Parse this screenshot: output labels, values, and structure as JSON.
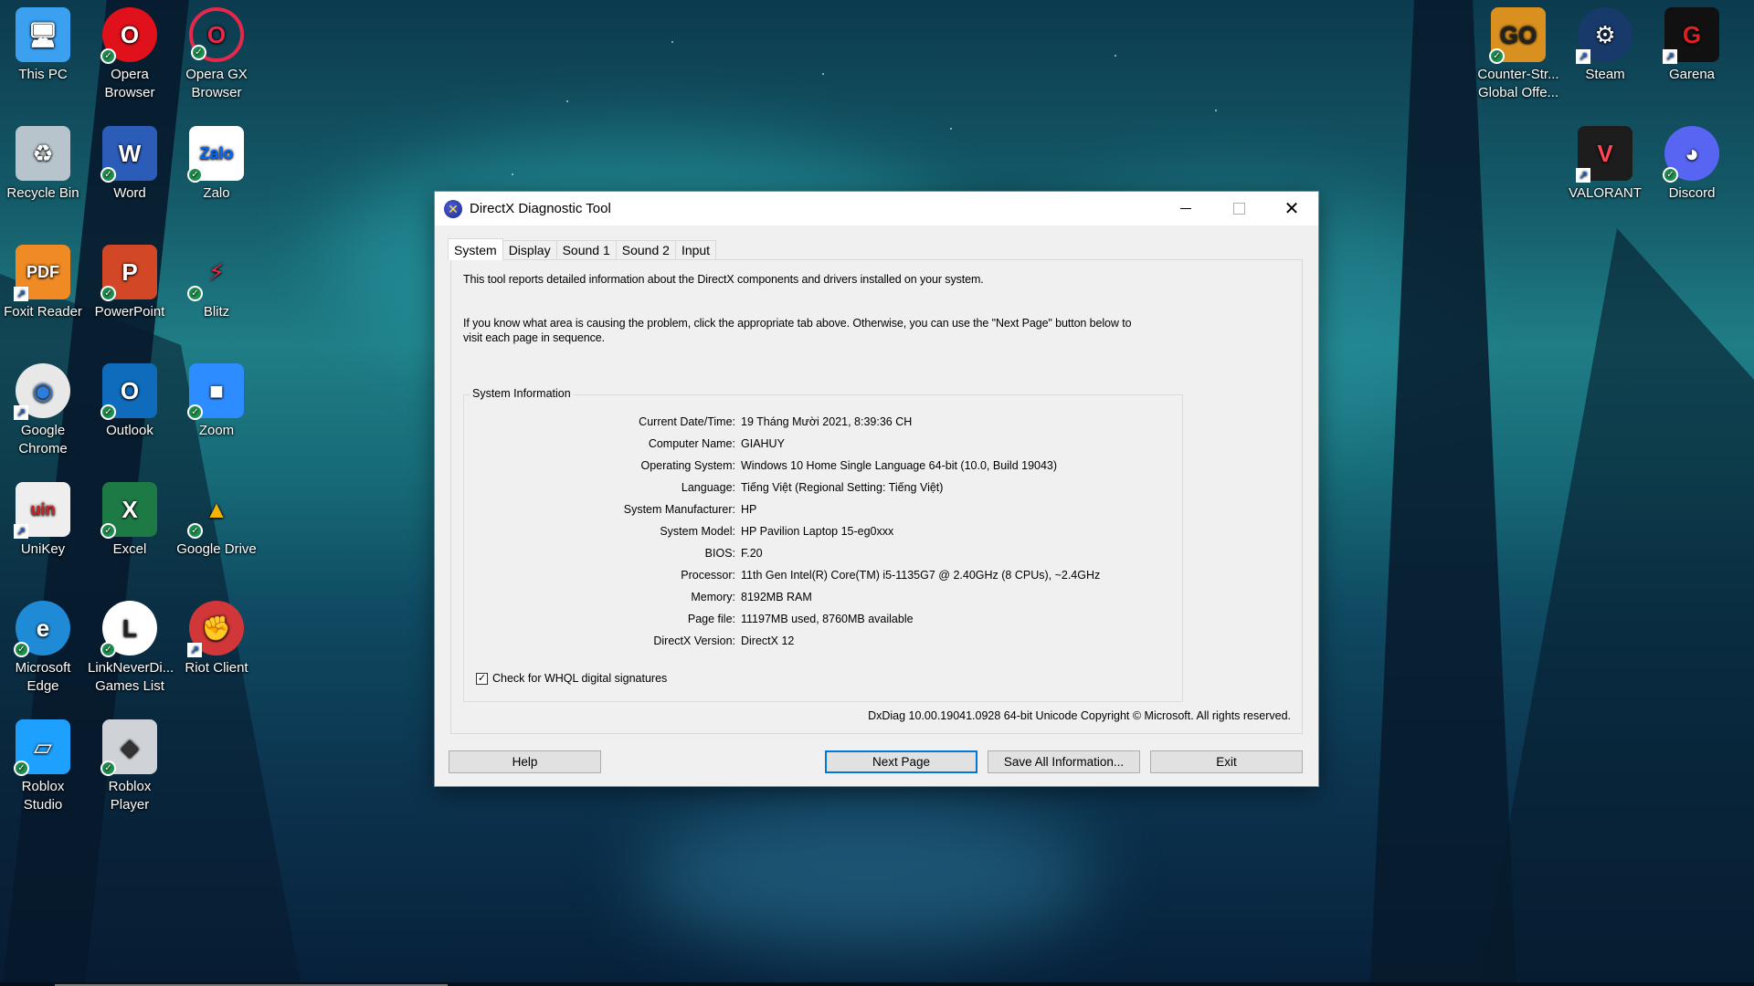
{
  "desktop": {
    "icons_left": [
      {
        "label": "This PC",
        "icon": "computer-icon",
        "badge": "none"
      },
      {
        "label": "Opera Browser",
        "icon": "opera-icon",
        "badge": "synced"
      },
      {
        "label": "Opera GX Browser",
        "icon": "opera-gx-icon",
        "badge": "synced"
      },
      {
        "label": "Recycle Bin",
        "icon": "recycle-bin-icon",
        "badge": "none"
      },
      {
        "label": "Word",
        "icon": "word-icon",
        "badge": "synced"
      },
      {
        "label": "Zalo",
        "icon": "zalo-icon",
        "badge": "synced"
      },
      {
        "label": "Foxit Reader",
        "icon": "foxit-reader-icon",
        "badge": "shortcut"
      },
      {
        "label": "PowerPoint",
        "icon": "powerpoint-icon",
        "badge": "synced"
      },
      {
        "label": "Blitz",
        "icon": "blitz-icon",
        "badge": "synced"
      },
      {
        "label": "Google Chrome",
        "icon": "chrome-icon",
        "badge": "shortcut"
      },
      {
        "label": "Outlook",
        "icon": "outlook-icon",
        "badge": "synced"
      },
      {
        "label": "Zoom",
        "icon": "zoom-icon",
        "badge": "synced"
      },
      {
        "label": "UniKey",
        "icon": "unikey-icon",
        "badge": "shortcut"
      },
      {
        "label": "Excel",
        "icon": "excel-icon",
        "badge": "synced"
      },
      {
        "label": "Google Drive",
        "icon": "google-drive-icon",
        "badge": "synced"
      },
      {
        "label": "Microsoft Edge",
        "icon": "edge-icon",
        "badge": "synced"
      },
      {
        "label": "LinkNeverDi... Games List",
        "icon": "linkneverdie-icon",
        "badge": "synced"
      },
      {
        "label": "Riot Client",
        "icon": "riot-client-icon",
        "badge": "shortcut"
      },
      {
        "label": "Roblox Studio",
        "icon": "roblox-studio-icon",
        "badge": "synced"
      },
      {
        "label": "Roblox Player",
        "icon": "roblox-player-icon",
        "badge": "synced"
      }
    ],
    "icons_right": [
      {
        "label": "Counter-Str... Global Offe...",
        "icon": "csgo-icon",
        "badge": "synced"
      },
      {
        "label": "Steam",
        "icon": "steam-icon",
        "badge": "shortcut"
      },
      {
        "label": "Garena",
        "icon": "garena-icon",
        "badge": "shortcut"
      },
      {
        "label": "VALORANT",
        "icon": "valorant-icon",
        "badge": "shortcut"
      },
      {
        "label": "Discord",
        "icon": "discord-icon",
        "badge": "synced"
      }
    ]
  },
  "dialog": {
    "title": "DirectX Diagnostic Tool",
    "tabs": [
      "System",
      "Display",
      "Sound 1",
      "Sound 2",
      "Input"
    ],
    "active_tab": "System",
    "intro1": "This tool reports detailed information about the DirectX components and drivers installed on your system.",
    "intro2a": "If you know what area is causing the problem, click the appropriate tab above.  Otherwise, you can use the \"Next Page\" button below to",
    "intro2b": "visit each page in sequence.",
    "group_title": "System Information",
    "info": [
      {
        "key": "Current Date/Time:",
        "value": "19 Tháng Mười 2021, 8:39:36 CH"
      },
      {
        "key": "Computer Name:",
        "value": "GIAHUY"
      },
      {
        "key": "Operating System:",
        "value": "Windows 10 Home Single Language 64-bit (10.0, Build 19043)"
      },
      {
        "key": "Language:",
        "value": "Tiếng Việt (Regional Setting: Tiếng Việt)"
      },
      {
        "key": "System Manufacturer:",
        "value": "HP"
      },
      {
        "key": "System Model:",
        "value": "HP Pavilion Laptop 15-eg0xxx"
      },
      {
        "key": "BIOS:",
        "value": "F.20"
      },
      {
        "key": "Processor:",
        "value": "11th Gen Intel(R) Core(TM) i5-1135G7 @ 2.40GHz (8 CPUs), ~2.4GHz"
      },
      {
        "key": "Memory:",
        "value": "8192MB RAM"
      },
      {
        "key": "Page file:",
        "value": "11197MB used, 8760MB available"
      },
      {
        "key": "DirectX Version:",
        "value": "DirectX 12"
      }
    ],
    "whql_label": "Check for WHQL digital signatures",
    "whql_checked": true,
    "footer": "DxDiag 10.00.19041.0928 64-bit Unicode  Copyright © Microsoft. All rights reserved.",
    "buttons": {
      "help": "Help",
      "next": "Next Page",
      "save": "Save All Information...",
      "exit": "Exit"
    }
  }
}
